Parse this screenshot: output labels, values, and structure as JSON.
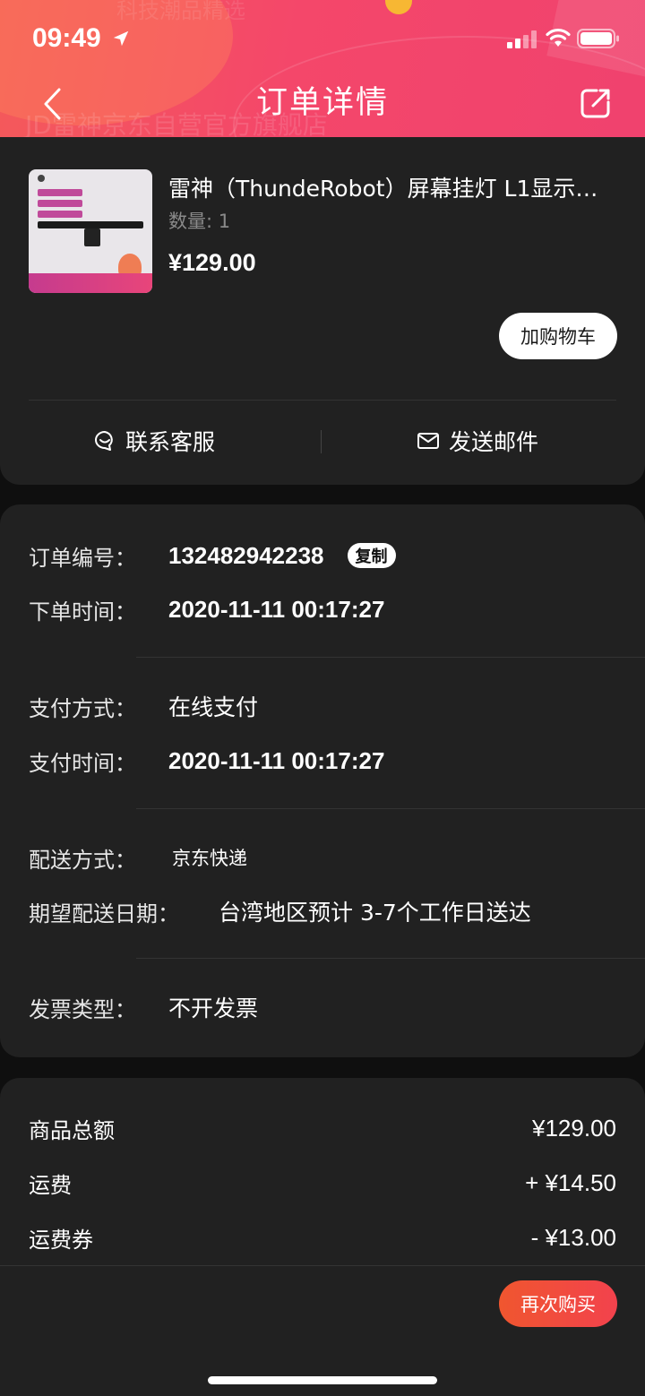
{
  "status_bar": {
    "time": "09:49"
  },
  "header": {
    "title": "订单详情",
    "background_text_top": "科技潮品精选",
    "background_text_store": "JD雷神京东自营官方旗舰店"
  },
  "product": {
    "title": "雷神（ThundeRobot）屏幕挂灯 L1显示器…",
    "quantity": "数量: 1",
    "price": "¥129.00",
    "add_to_cart_label": "加购物车"
  },
  "actions": {
    "contact_service": "联系客服",
    "send_email": "发送邮件"
  },
  "order_info": {
    "order_number_label": "订单编号：",
    "order_number": "132482942238",
    "copy_label": "复制",
    "order_time_label": "下单时间：",
    "order_time": "2020-11-11 00:17:27",
    "payment_method_label": "支付方式：",
    "payment_method": "在线支付",
    "payment_time_label": "支付时间：",
    "payment_time": "2020-11-11 00:17:27",
    "delivery_method_label": "配送方式：",
    "delivery_method": "京东快递",
    "expected_date_label": "期望配送日期：",
    "expected_date": "台湾地区预计 3-7个工作日送达",
    "invoice_type_label": "发票类型：",
    "invoice_type": "不开发票"
  },
  "price_summary": {
    "goods_total_label": "商品总额",
    "goods_total": "¥129.00",
    "shipping_label": "运费",
    "shipping": "+ ¥14.50",
    "shipping_coupon_label": "运费券",
    "shipping_coupon": "- ¥13.00"
  },
  "footer": {
    "buy_again_label": "再次购买"
  },
  "colors": {
    "header_gradient_start": "#f45a5a",
    "header_gradient_end": "#f0426e",
    "card_background": "#212121",
    "page_background": "#0f0f0f",
    "buy_again": "#f0562f"
  },
  "icons": [
    "location-arrow-icon",
    "signal-icon",
    "wifi-icon",
    "battery-icon",
    "back-chevron-icon",
    "share-icon",
    "customer-service-icon",
    "mail-icon"
  ]
}
